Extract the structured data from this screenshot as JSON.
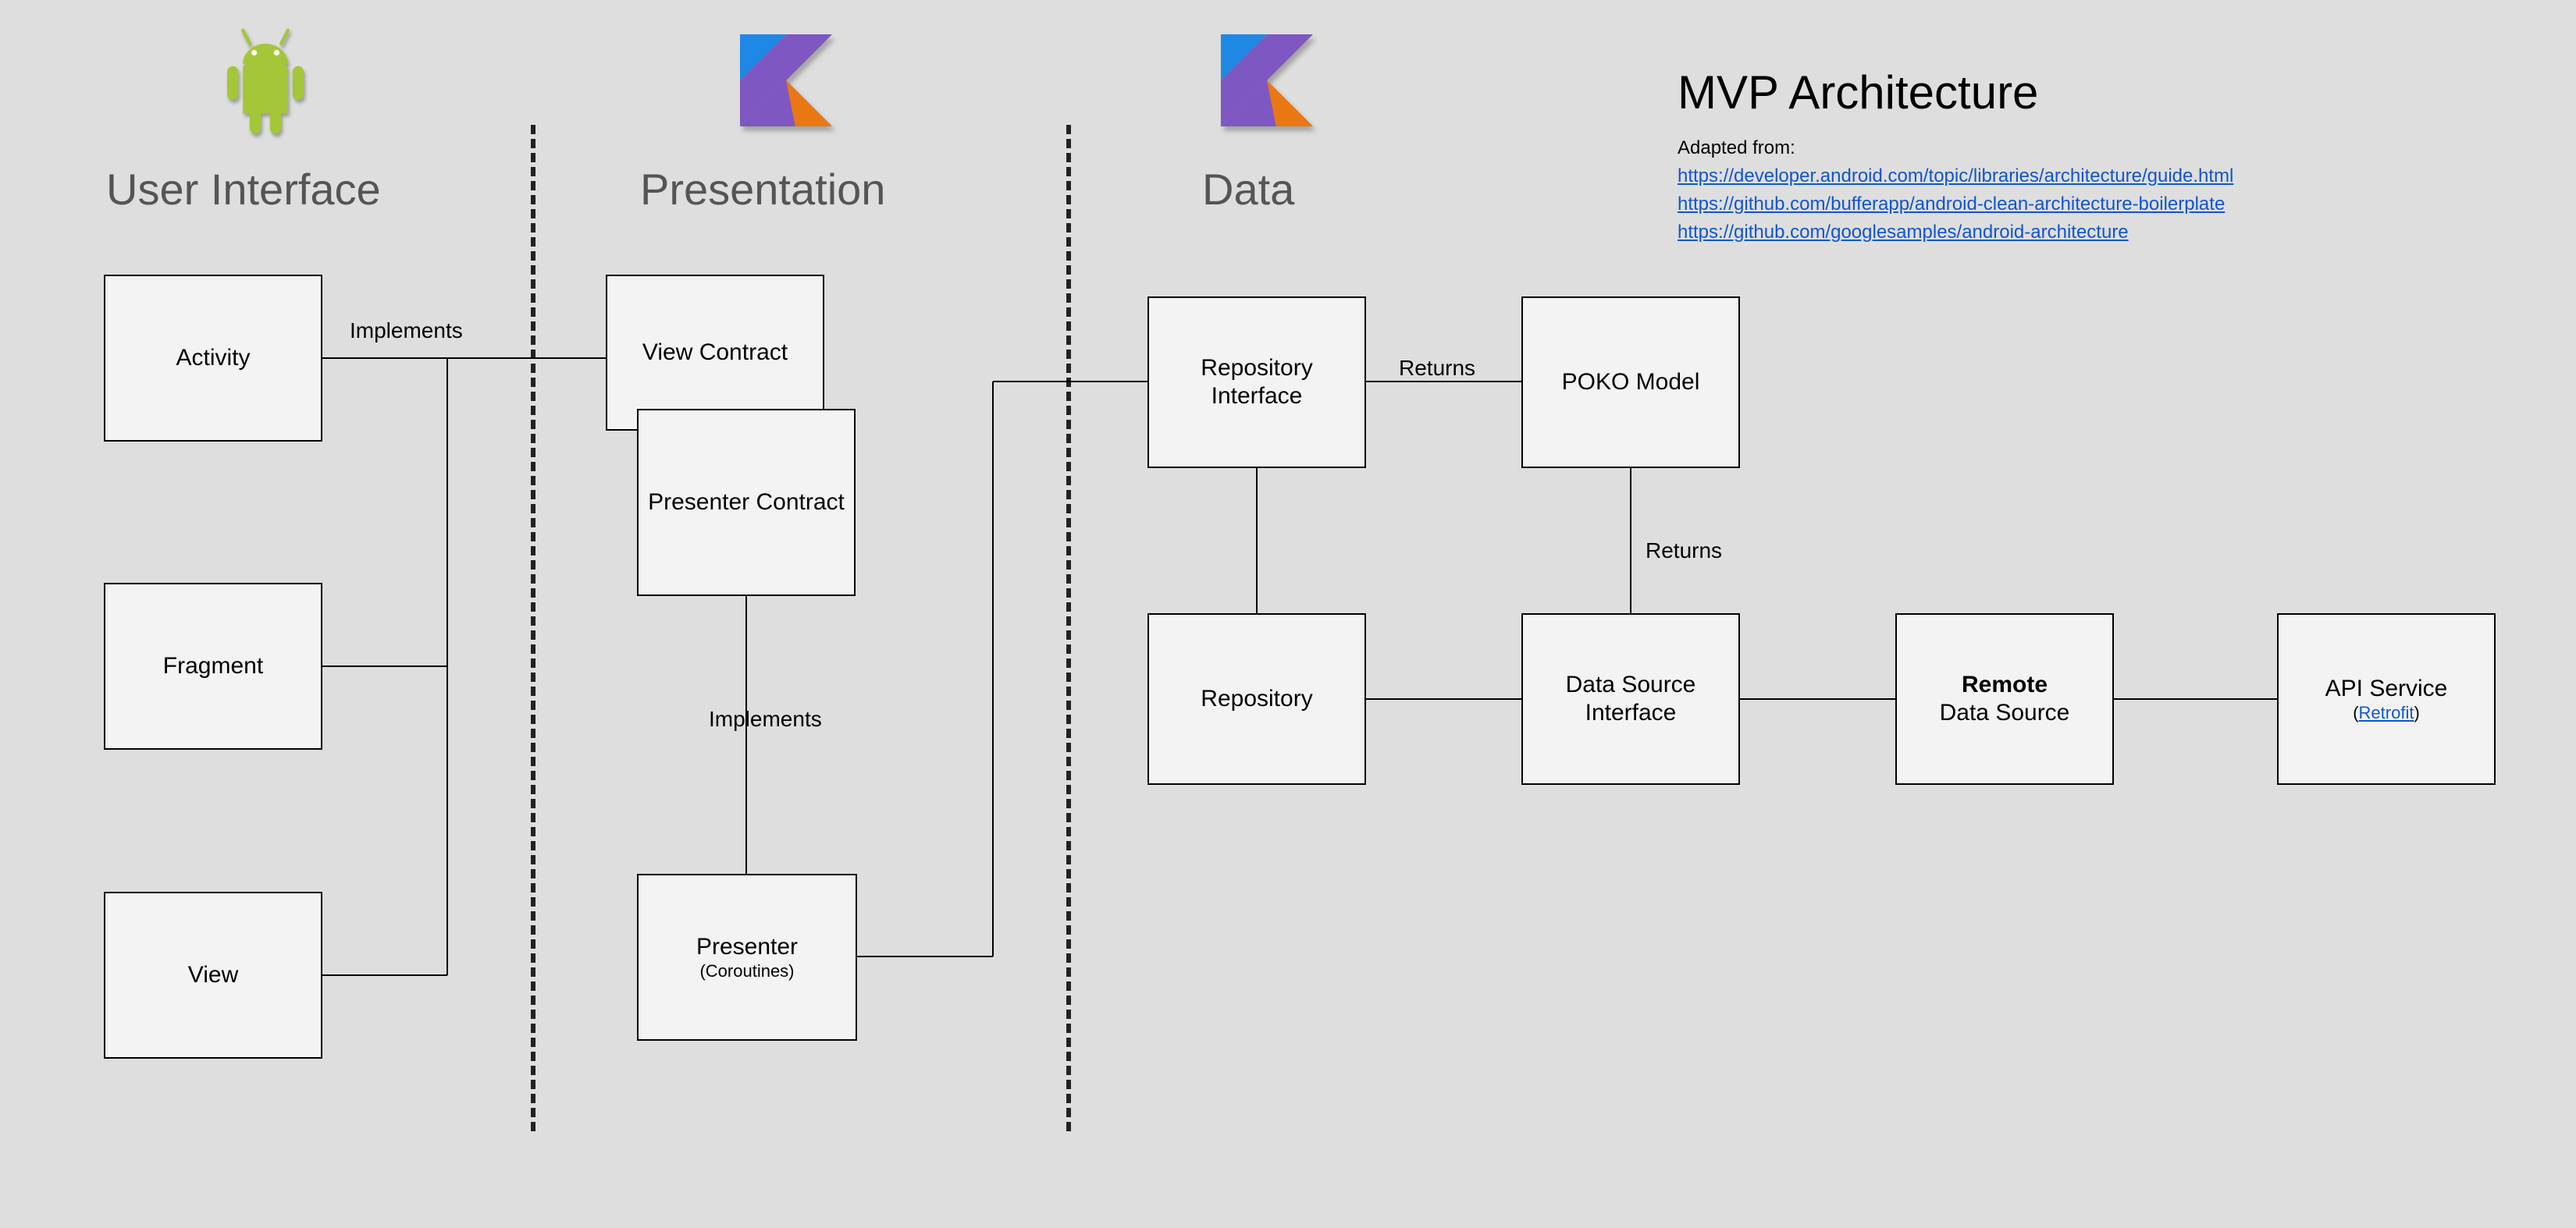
{
  "sections": {
    "ui": "User Interface",
    "presentation": "Presentation",
    "data": "Data"
  },
  "header": {
    "title": "MVP Architecture",
    "adapted": "Adapted from:",
    "links": [
      "https://developer.android.com/topic/libraries/architecture/guide.html",
      "https://github.com/bufferapp/android-clean-architecture-boilerplate",
      "https://github.com/googlesamples/android-architecture"
    ]
  },
  "boxes": {
    "activity": "Activity",
    "fragment": "Fragment",
    "view": "View",
    "view_contract": "View Contract",
    "presenter_contract": "Presenter Contract",
    "presenter": "Presenter",
    "presenter_sub": "(Coroutines)",
    "repo_iface": "Repository Interface",
    "repository": "Repository",
    "poko": "POKO Model",
    "ds_iface": "Data Source Interface",
    "remote_ds_strong": "Remote",
    "remote_ds_rest": "Data Source",
    "api_service": "API Service",
    "api_sub_open": "(",
    "api_sub_link": "Retrofit",
    "api_sub_close": ")"
  },
  "edges": {
    "implements1": "Implements",
    "implements2": "Implements",
    "returns1": "Returns",
    "returns2": "Returns"
  }
}
